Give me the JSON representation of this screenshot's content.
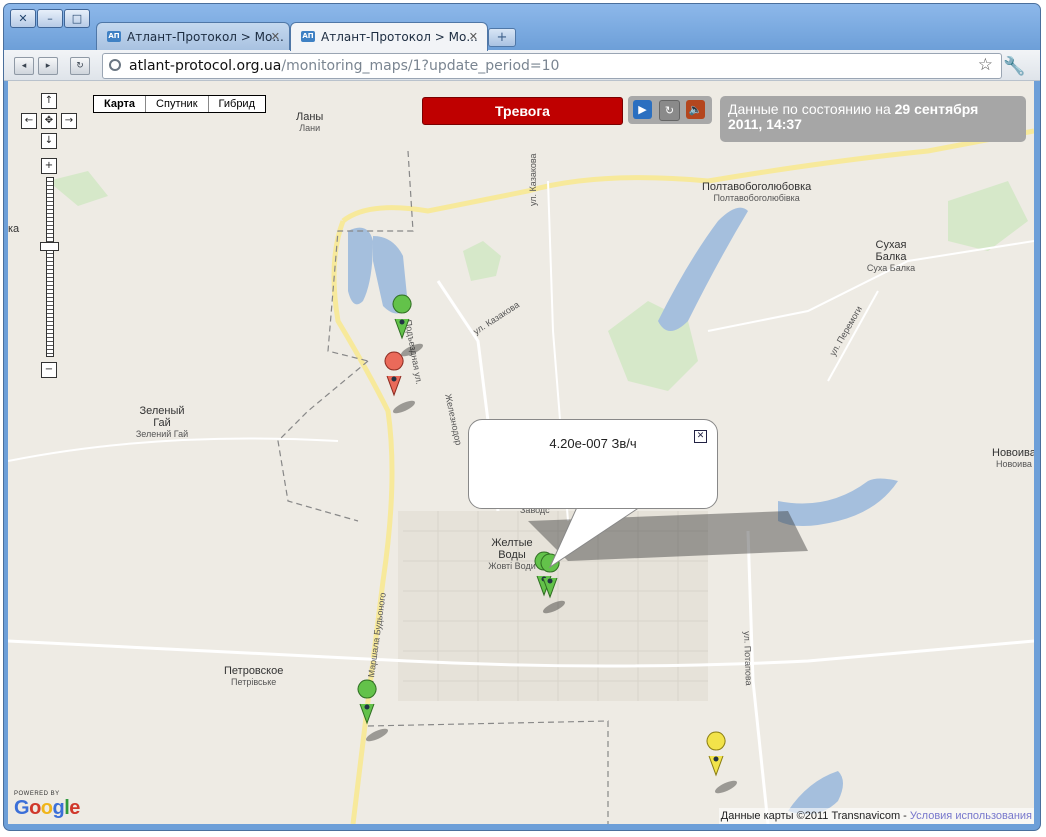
{
  "window": {
    "close_glyph": "✕",
    "minimize_glyph": "–",
    "maximize_glyph": "□"
  },
  "tabs": [
    {
      "favicon": "АП",
      "label": "Атлант-Протокол > Мо...",
      "close": "✕",
      "active": false
    },
    {
      "favicon": "АП",
      "label": "Атлант-Протокол > Мо...",
      "close": "✕",
      "active": true
    }
  ],
  "new_tab_glyph": "+",
  "toolbar": {
    "back_glyph": "◂",
    "forward_glyph": "▸",
    "reload_glyph": "↻",
    "url_host": "atlant-protocol.org.ua",
    "url_path": "/monitoring_maps/1?update_period=10",
    "star_glyph": "☆",
    "wrench_glyph": "🔧"
  },
  "map_controls": {
    "pan_up": "↑",
    "pan_left": "←",
    "pan_center": "✥",
    "pan_right": "→",
    "pan_down": "↓",
    "zoom_in": "+",
    "zoom_out": "−",
    "zoom_level": 0.38
  },
  "map_types": [
    "Карта",
    "Спутник",
    "Гибрид"
  ],
  "alarm_button": "Тревога",
  "playback": {
    "play_glyph": "▶",
    "refresh_glyph": "↻",
    "sound_glyph": "🔈"
  },
  "status": {
    "prefix": "Данные по состоянию на ",
    "date": "29 сентября",
    "time": "2011, 14:37"
  },
  "popup": {
    "reading": "4.20e-007 Зв/ч",
    "close_glyph": "✕"
  },
  "places": [
    {
      "name": "Ланы",
      "sub": "Лани"
    },
    {
      "name": "Полтавобоголюбовка",
      "sub": "Полтавобоголюбівка"
    },
    {
      "name": "Сухая Балка",
      "sub": "Суха Балка"
    },
    {
      "name": "Зеленый Гай",
      "sub": "Зелений Гай"
    },
    {
      "name": "Желтые Воды",
      "sub": "Жовті Води"
    },
    {
      "name": "Петровское",
      "sub": "Петрівське"
    },
    {
      "name": "Новоива",
      "sub": "Новоива"
    },
    {
      "name": "ка",
      "sub": ""
    }
  ],
  "streets": [
    "ул. Казакова",
    "ул. Казакова",
    "Подъездная ул.",
    "Железнодор",
    "ул. Перемоги",
    "ул. Маршала Будьоного",
    "ул. Потапова",
    "Заводс"
  ],
  "markers": [
    {
      "color": "#63c24a",
      "name": "green"
    },
    {
      "color": "#ea6a5a",
      "name": "red"
    },
    {
      "color": "#63c24a",
      "name": "green"
    },
    {
      "color": "#63c24a",
      "name": "green"
    },
    {
      "color": "#63c24a",
      "name": "green"
    },
    {
      "color": "#f2e34a",
      "name": "yellow"
    }
  ],
  "attribution": {
    "text": "Данные карты ©2011 Transnavicom - ",
    "link": "Условия использования"
  },
  "google": {
    "powered": "POWERED BY",
    "logo": "Google"
  }
}
